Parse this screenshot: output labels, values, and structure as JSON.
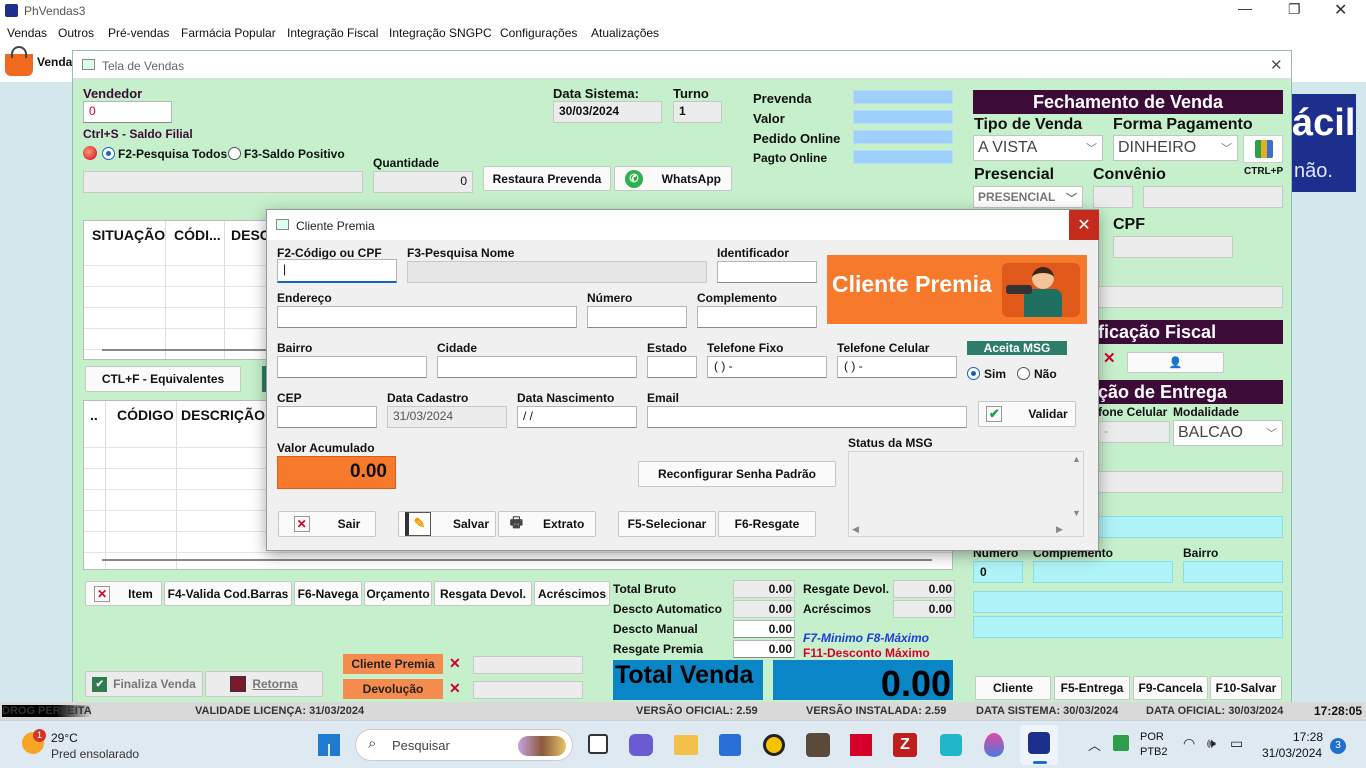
{
  "app": {
    "title": "PhVendas3",
    "menu": [
      "Vendas",
      "Outros",
      "Pré-vendas",
      "Farmácia Popular",
      "Integração Fiscal",
      "Integração SNGPC",
      "Configurações",
      "Atualizações"
    ],
    "toolbar_label": "Venda"
  },
  "banner": {
    "text1": "ácil",
    "text2": "não."
  },
  "main": {
    "title": "Tela de Vendas",
    "vendedor_label": "Vendedor",
    "vendedor_value": "0",
    "saldo_label": "Ctrl+S - Saldo Filial",
    "radio1": "F2-Pesquisa Todos",
    "radio2": "F3-Saldo Positivo",
    "qtd_label": "Quantidade",
    "qtd_value": "0",
    "data_label": "Data Sistema:",
    "data_value": "30/03/2024",
    "turno_label": "Turno",
    "turno_value": "1",
    "restaura": "Restaura Prevenda",
    "whatsapp": "WhatsApp",
    "prevenda": "Prevenda",
    "valor": "Valor",
    "pedido": "Pedido Online",
    "pagto": "Pagto Online",
    "grid1_cols": [
      "SITUAÇÃO",
      "CÓDI...",
      "DESC"
    ],
    "equiv": "CTL+F - Equivalentes",
    "grid2_cols": [
      "..",
      "CÓDIGO",
      "DESCRIÇÃO"
    ],
    "bottom_btns": [
      "Item",
      "F4-Valida Cod.Barras",
      "F6-Navega",
      "Orçamento",
      "Resgata Devol.",
      "Acréscimos"
    ],
    "totals_left": [
      [
        "Total Bruto",
        "0.00"
      ],
      [
        "Descto Automatico",
        "0.00"
      ],
      [
        "Descto Manual",
        "0.00"
      ],
      [
        "Resgate Premia",
        "0.00"
      ]
    ],
    "totals_right": [
      [
        "Resgate Devol.",
        "0.00"
      ],
      [
        "Acréscimos",
        "0.00"
      ]
    ],
    "f7": "F7-Minimo F8-Máximo",
    "f11": "F11-Desconto Máximo",
    "total_label": "Total Venda",
    "total_value": "0.00",
    "finaliza": "Finaliza Venda",
    "retorna": "Retorna",
    "cliente_premia_btn": "Cliente Premia",
    "devolucao_btn": "Devolução"
  },
  "right": {
    "fechamento": "Fechamento de Venda",
    "tipo_label": "Tipo de Venda",
    "tipo_value": "A VISTA",
    "forma_label": "Forma Pagamento",
    "forma_value": "DINHEIRO",
    "ctrlp": "CTRL+P",
    "presencial_label": "Presencial",
    "presencial_value": "PRESENCIAL",
    "convenio_label": "Convênio",
    "cpf_label": "CPF",
    "fiscal_hdr": "ficação Fiscal",
    "entrega_hdr": "ção de Entrega",
    "tel_cel": "fone Celular",
    "tel_val": "-",
    "modalidade": "Modalidade",
    "modalidade_value": "BALCAO",
    "numero": "Número",
    "numero_value": "0",
    "complemento": "Complemento",
    "bairro": "Bairro",
    "actions": [
      "Cliente",
      "F5-Entrega",
      "F9-Cancela",
      "F10-Salvar"
    ]
  },
  "dialog": {
    "title": "Cliente Premia",
    "codigo_label": "F2-Código ou CPF",
    "nome_label": "F3-Pesquisa Nome",
    "ident_label": "Identificador",
    "logo_text": "Cliente Premia",
    "endereco": "Endereço",
    "numero": "Número",
    "complemento": "Complemento",
    "bairro": "Bairro",
    "cidade": "Cidade",
    "estado": "Estado",
    "tel_fixo": "Telefone Fixo",
    "tel_fixo_value": "(  )    -",
    "tel_cel": "Telefone Celular",
    "tel_cel_value": "(  )    -",
    "aceita": "Aceita MSG",
    "sim": "Sim",
    "nao": "Não",
    "cep": "CEP",
    "data_cad": "Data Cadastro",
    "data_cad_value": "31/03/2024",
    "data_nasc": "Data Nascimento",
    "data_nasc_value": "  /  /",
    "email": "Email",
    "validar": "Validar",
    "valor_acum": "Valor Acumulado",
    "valor_acum_value": "0.00",
    "reconfig": "Reconfigurar Senha Padrão",
    "status": "Status da MSG",
    "sair": "Sair",
    "salvar": "Salvar",
    "extrato": "Extrato",
    "f5": "F5-Selecionar",
    "f6": "F6-Resgate"
  },
  "status_bar": {
    "items": [
      "DROG PERFEITA",
      "VALIDADE LICENÇA: 31/03/2024",
      "VERSÃO OFICIAL: 2.59",
      "VERSÃO INSTALADA: 2.59",
      "DATA SISTEMA: 30/03/2024",
      "DATA OFICIAL: 30/03/2024"
    ],
    "clock": "17:28:05"
  },
  "taskbar": {
    "temp": "29°C",
    "weather": "Pred ensolarado",
    "search": "Pesquisar",
    "lang1": "POR",
    "lang2": "PTB2",
    "time": "17:28",
    "date": "31/03/2024",
    "badge": "3",
    "weather_badge": "1"
  }
}
